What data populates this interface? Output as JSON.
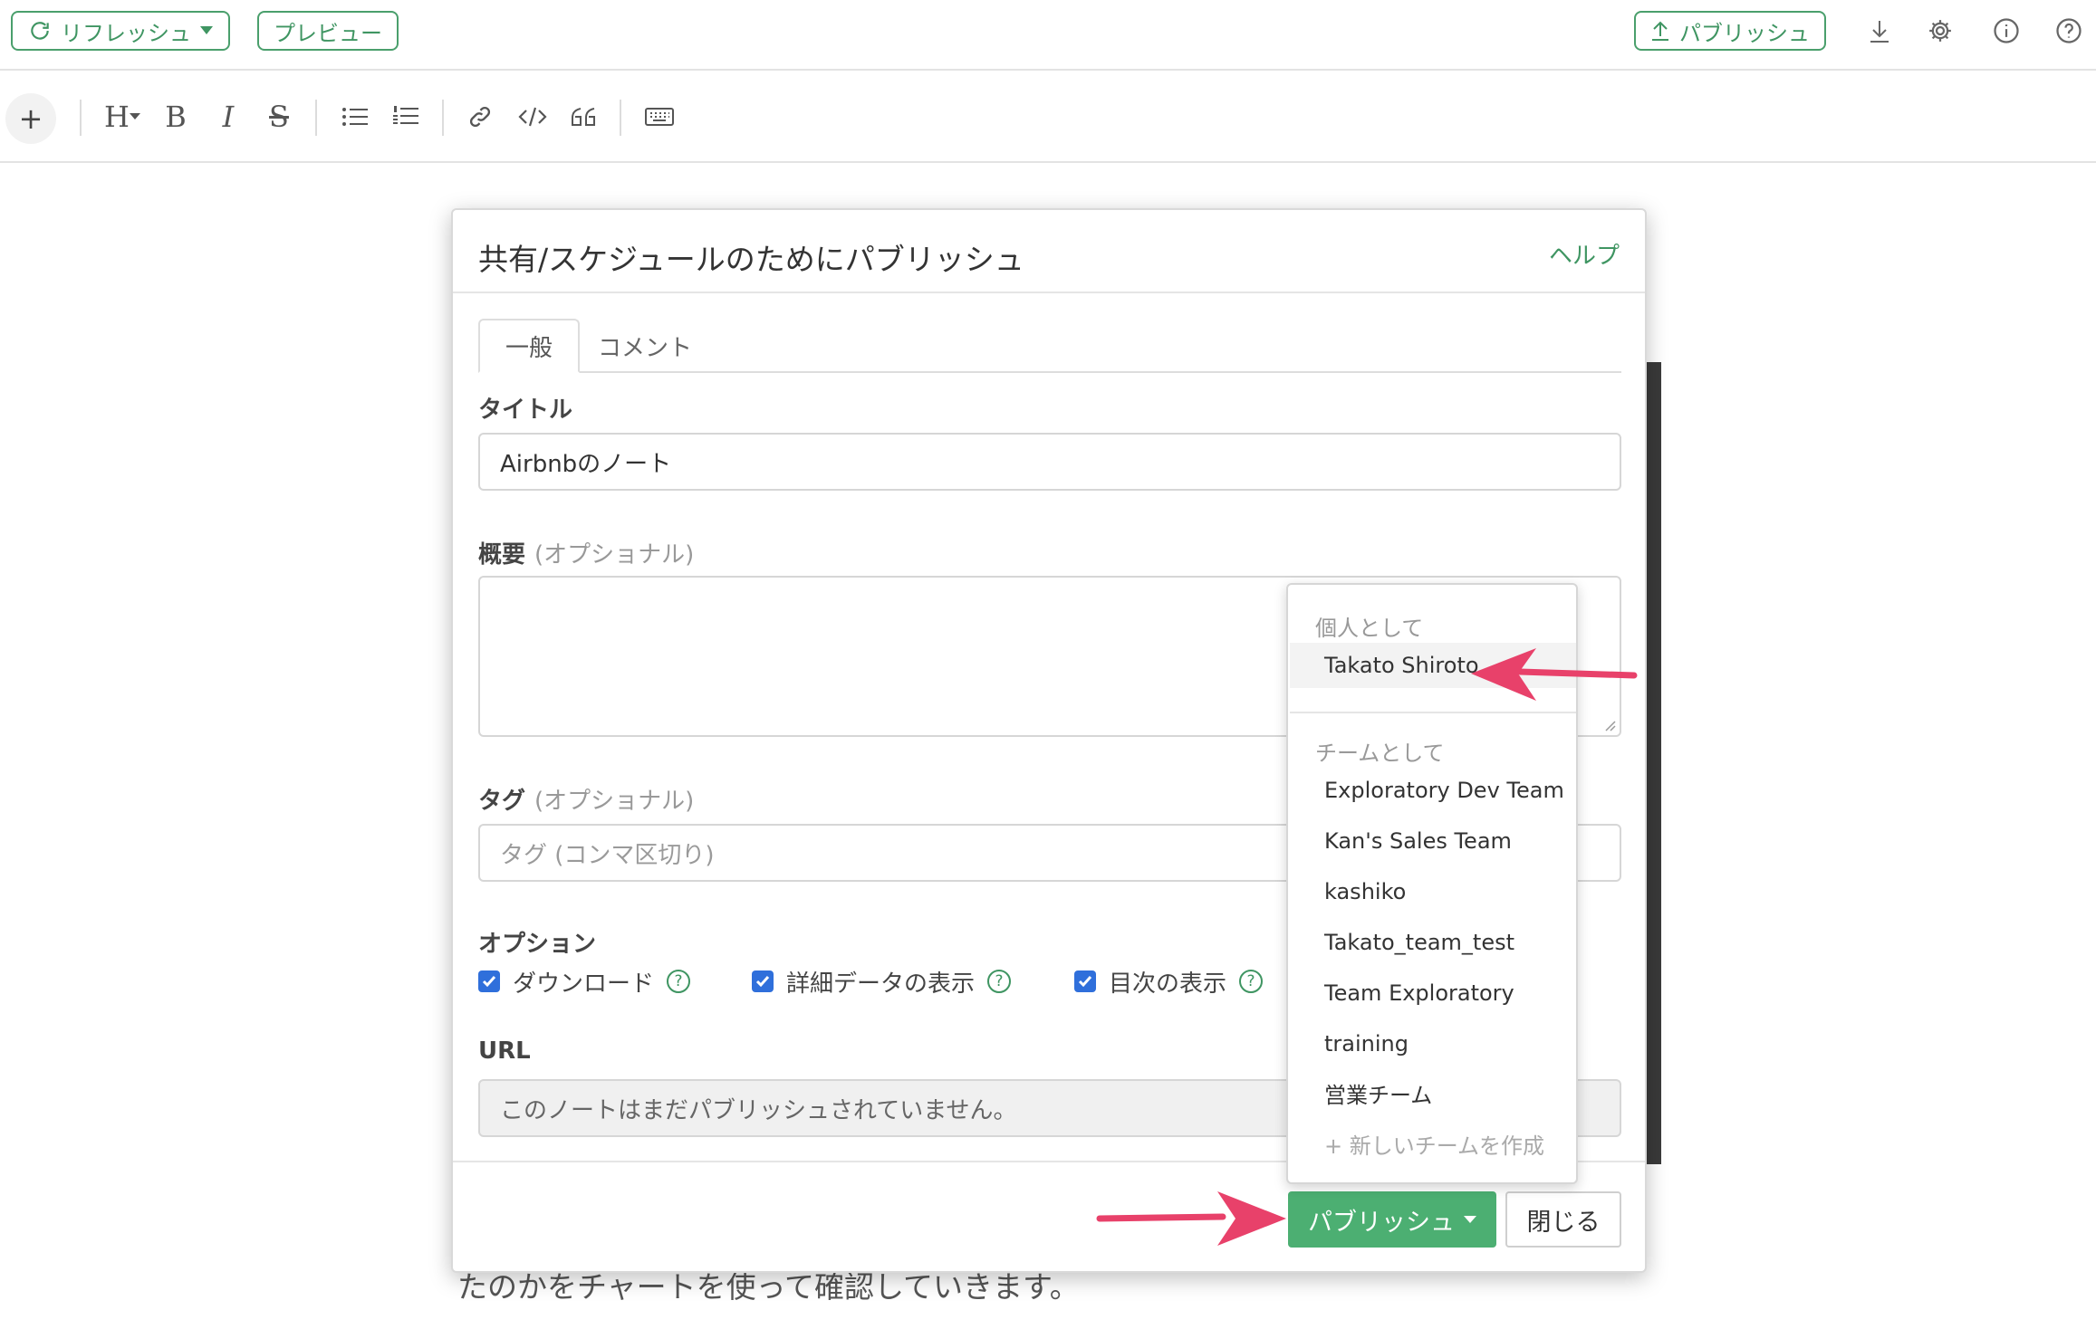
{
  "topbar": {
    "refresh_label": "リフレッシュ",
    "preview_label": "プレビュー",
    "publish_label": "パブリッシュ"
  },
  "toolbar": {
    "add": "+",
    "heading": "H",
    "bold": "B",
    "italic": "I",
    "strike": "S"
  },
  "background_text": "たのかをチャートを使って確認していきます。",
  "modal": {
    "title": "共有/スケジュールのためにパブリッシュ",
    "help": "ヘルプ",
    "tabs": [
      {
        "label": "一般"
      },
      {
        "label": "コメント"
      }
    ],
    "title_label": "タイトル",
    "title_value": "Airbnbのノート",
    "summary_label": "概要",
    "optional": "(オプショナル)",
    "tags_label": "タグ",
    "tags_placeholder": "タグ (コンマ区切り)",
    "options_label": "オプション",
    "options": [
      {
        "label": "ダウンロード",
        "checked": true
      },
      {
        "label": "詳細データの表示",
        "checked": true
      },
      {
        "label": "目次の表示",
        "checked": true
      }
    ],
    "url_label": "URL",
    "url_value": "このノートはまだパブリッシュされていません。",
    "publish_button": "パブリッシュ",
    "close_button": "閉じる"
  },
  "dropdown": {
    "personal_header": "個人として",
    "personal_items": [
      "Takato Shiroto"
    ],
    "team_header": "チームとして",
    "team_items": [
      "Exploratory Dev Team",
      "Kan's Sales Team",
      "kashiko",
      "Takato_team_test",
      "Team Exploratory",
      "training",
      "営業チーム"
    ],
    "create_team": "+ 新しいチームを作成"
  },
  "colors": {
    "brand_green": "#4caf72",
    "checkbox_blue": "#2f6fdb",
    "annotation_arrow": "#e8416a"
  }
}
